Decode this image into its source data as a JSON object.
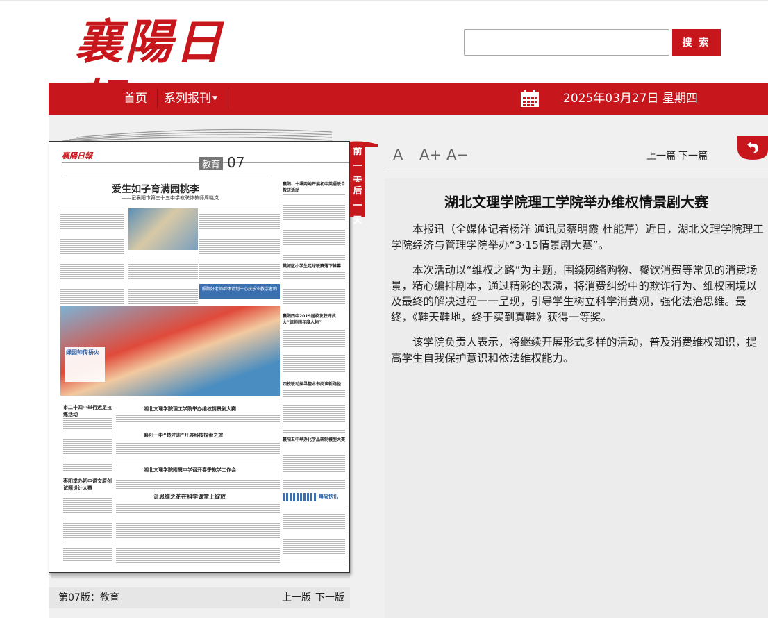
{
  "header": {
    "logo_text": "襄陽日報",
    "search_placeholder": "",
    "search_button": "搜 索"
  },
  "nav": {
    "home": "首页",
    "series": "系列报刊",
    "date": "2025年03月27日 星期四"
  },
  "side_tabs": {
    "prev_day": "前一天",
    "next_day": "后一天"
  },
  "page_footer": {
    "label": "第07版：教育",
    "prev": "上一版",
    "next": "下一版"
  },
  "article_toolbar": {
    "font_normal": "A",
    "font_larger": "A+",
    "font_smaller": "A−",
    "prev": "上一篇",
    "next": "下一篇"
  },
  "article": {
    "title": "湖北文理学院理工学院举办维权情景剧大赛",
    "paragraphs": [
      "本报讯（全媒体记者杨洋 通讯员蔡明霞 杜能芹）近日，湖北文理学院理工学院经济与管理学院举办“3·15情景剧大赛”。",
      "本次活动以“维权之路”为主题，围绕网络购物、餐饮消费等常见的消费场景，精心编排剧本，通过精彩的表演，将消费纠纷中的欺诈行为、维权困境以及最终的解决过程一一呈现，引导学生树立科学消费观，强化法治思维。最终，《鞋天鞋地，终于买到真鞋》获得一等奖。",
      "该学院负责人表示，将继续开展形式多样的活动，普及消费维权知识，提高学生自我保护意识和依法维权能力。"
    ]
  },
  "newspaper": {
    "masthead": "襄陽日報",
    "section": "教育",
    "page_no": "07",
    "headline": "爱生如子育满园桃李",
    "subhead": "——记襄阳市第三十五中学教联体教师周晓岚",
    "side_items": [
      "襄阳、十堰两地开展初中英语联合教研活动",
      "樊城区小学生足球联赛落下帷幕",
      "襄阳四中2019届校友获评武大“律师团年度人物”",
      "四校联动探寻整本书阅读新路径",
      "襄阳五中举办化学品研制模型大赛"
    ],
    "photo_caption": "绿园帅传桥火",
    "bottom_heads": [
      "湖北文理学院理工学院举办维权情景剧大赛",
      "襄阳一中“楚才班”开展科技探索之旅",
      "湖北文理学院附属中学召开春季教学工作会",
      "让思维之花在科学课堂上绽放"
    ],
    "left_items": [
      "市二十四中举行远足拉练活动",
      "枣阳举办初中语文原创试题设计大赛"
    ],
    "blue_box": "照顾好老师群体计划一心扶乐业教学者的",
    "brief": "每周快讯"
  }
}
